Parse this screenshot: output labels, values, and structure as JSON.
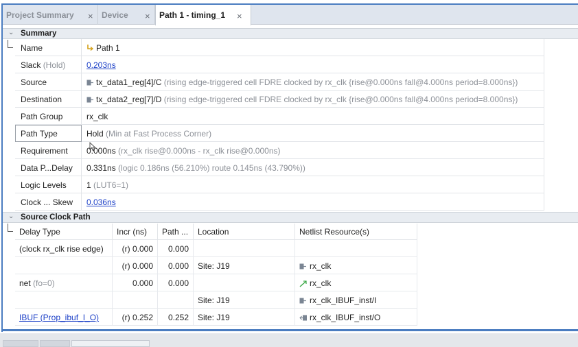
{
  "tabs": [
    {
      "label": "Project Summary",
      "close": "×"
    },
    {
      "label": "Device",
      "close": "×"
    },
    {
      "label": "Path 1 - timing_1",
      "close": "×"
    }
  ],
  "summary": {
    "section_title": "Summary",
    "chevron": "⌄",
    "rows": [
      {
        "key": "Name",
        "value": "Path 1",
        "icon": "path-icon"
      },
      {
        "key": "Slack",
        "key_dim": "(Hold)",
        "value_link": "0.203ns"
      },
      {
        "key": "Source",
        "icon": "cell-icon",
        "value": "tx_data1_reg[4]/C",
        "value_dim": "(rising edge-triggered cell FDRE clocked by rx_clk {rise@0.000ns fall@4.000ns period=8.000ns})"
      },
      {
        "key": "Destination",
        "icon": "cell-icon",
        "value": "tx_data2_reg[7]/D",
        "value_dim": "(rising edge-triggered cell FDRE clocked by rx_clk {rise@0.000ns fall@4.000ns period=8.000ns})"
      },
      {
        "key": "Path Group",
        "value": "rx_clk"
      },
      {
        "key": "Path Type",
        "value": "Hold",
        "value_dim": "(Min at Fast Process Corner)"
      },
      {
        "key": "Requirement",
        "value": "0.000ns",
        "value_dim": "(rx_clk rise@0.000ns - rx_clk rise@0.000ns)"
      },
      {
        "key": "Data P...Delay",
        "value": "0.331ns",
        "value_dim": "(logic 0.186ns (56.210%)  route 0.145ns (43.790%))"
      },
      {
        "key": "Logic Levels",
        "value": "1",
        "value_dim": "(LUT6=1)"
      },
      {
        "key": "Clock ... Skew",
        "value_link": "0.036ns"
      }
    ]
  },
  "clock_path": {
    "section_title": "Source Clock Path",
    "chevron": "⌄",
    "columns": [
      "Delay Type",
      "Incr (ns)",
      "Path ...",
      "Location",
      "Netlist Resource(s)"
    ],
    "rows": [
      {
        "delay_type": "(clock rx_clk rise edge)",
        "incr": "(r) 0.000",
        "path": "0.000",
        "location": "",
        "resource": "",
        "icon": ""
      },
      {
        "delay_type": "",
        "incr": "(r) 0.000",
        "path": "0.000",
        "location": "Site: J19",
        "resource": "rx_clk",
        "icon": "port-icon"
      },
      {
        "delay_type": "net",
        "delay_dim": "(fo=0)",
        "incr": "0.000",
        "path": "0.000",
        "location": "",
        "resource": "rx_clk",
        "icon": "net-icon"
      },
      {
        "delay_type": "",
        "incr": "",
        "path": "",
        "location": "Site: J19",
        "resource": "rx_clk_IBUF_inst/I",
        "icon": "port-icon"
      },
      {
        "delay_type_link": "IBUF (Prop_ibuf_I_O)",
        "incr": "(r) 0.252",
        "path": "0.252",
        "location": "Site: J19",
        "resource": "rx_clk_IBUF_inst/O",
        "icon": "out-port-icon"
      }
    ]
  },
  "colors": {
    "accent": "#4a7cc0",
    "link": "#1b3fc7",
    "dim": "#8c9097",
    "header_bg": "#e8ecf1"
  }
}
